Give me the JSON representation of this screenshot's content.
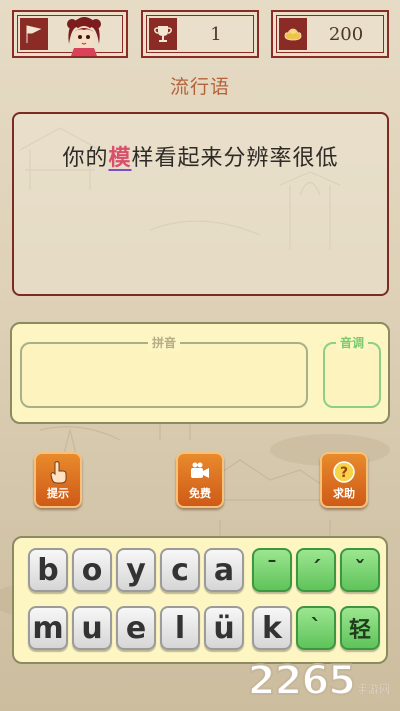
{
  "header": {
    "level": "1",
    "coins": "200"
  },
  "category": "流行语",
  "sentence": {
    "before": "你的",
    "highlight": "模",
    "after": "样看起来分辨率很低"
  },
  "answer": {
    "pinyin_label": "拼音",
    "tone_label": "音调"
  },
  "actions": {
    "hint": "提示",
    "free": "免费",
    "help": "求助"
  },
  "keyboard": {
    "row1_letters": [
      "b",
      "o",
      "y",
      "c",
      "a"
    ],
    "row1_tones": [
      "ˉ",
      "ˊ",
      "ˇ"
    ],
    "row2_letters": [
      "m",
      "u",
      "e",
      "l",
      "ü",
      "k"
    ],
    "row2_tones": [
      "ˋ",
      "轻"
    ]
  },
  "watermark": {
    "number": "2265",
    "text": "手游网"
  },
  "colors": {
    "frame": "#8a2c25",
    "highlight": "#d9506c",
    "action_orange": "#e07a26",
    "tone_green": "#6fcb62",
    "panel_yellow": "#fdf6c2"
  }
}
